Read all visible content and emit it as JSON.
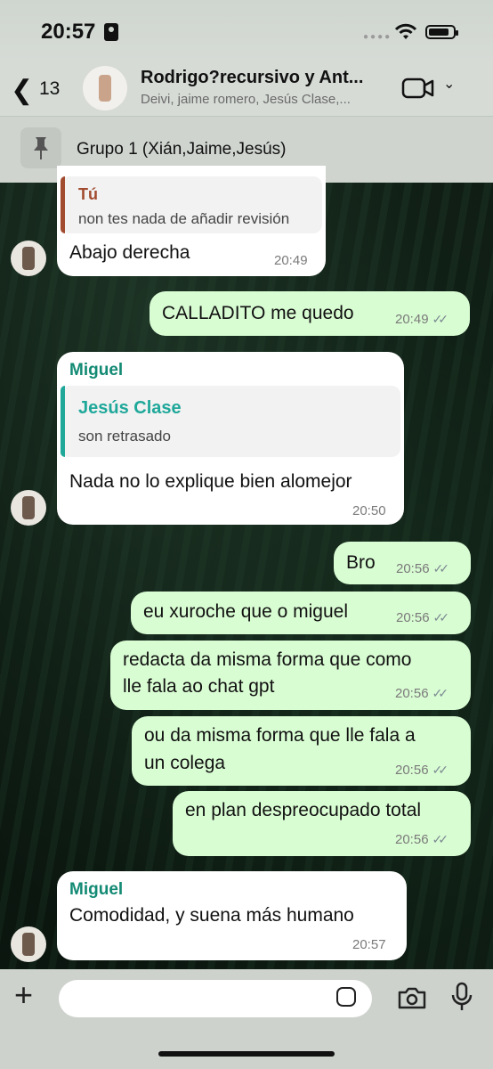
{
  "status": {
    "time": "20:57"
  },
  "header": {
    "back_count": "13",
    "title": "Rodrigo?recursivo y Ant...",
    "subtitle": "Deivi, jaime romero, Jesús Clase,..."
  },
  "pinned": {
    "text": "Grupo 1 (Xián,Jaime,Jesús)"
  },
  "messages": [
    {
      "dir": "in",
      "reply_sender": "Tú",
      "reply_text": "non tes nada de añadir revisión",
      "text": "Abajo derecha",
      "time": "20:49"
    },
    {
      "dir": "out",
      "text": "CALLADITO me quedo",
      "time": "20:49"
    },
    {
      "dir": "in",
      "sender": "Miguel",
      "reply_sender": "Jesús Clase",
      "reply_text": "son retrasado",
      "text": "Nada no lo explique bien alomejor",
      "time": "20:50"
    },
    {
      "dir": "out",
      "text": "Bro",
      "time": "20:56"
    },
    {
      "dir": "out",
      "text": "eu xuroche que o miguel",
      "time": "20:56"
    },
    {
      "dir": "out",
      "line1": "redacta da misma forma que como",
      "line2": "lle fala ao chat gpt",
      "time": "20:56"
    },
    {
      "dir": "out",
      "line1": "ou da misma forma que lle fala a",
      "line2": "un colega",
      "time": "20:56"
    },
    {
      "dir": "out",
      "text": "en plan despreocupado total",
      "time": "20:56"
    },
    {
      "dir": "in",
      "sender": "Miguel",
      "text": "Comodidad, y suena más humano",
      "time": "20:57"
    }
  ],
  "composer": {
    "placeholder": ""
  },
  "colors": {
    "sender_green": "#138a74",
    "out_bubble": "#d9fdd3",
    "in_bubble": "#ffffff",
    "reply_red": "#a14b2f",
    "reply_teal": "#1fa89a"
  }
}
